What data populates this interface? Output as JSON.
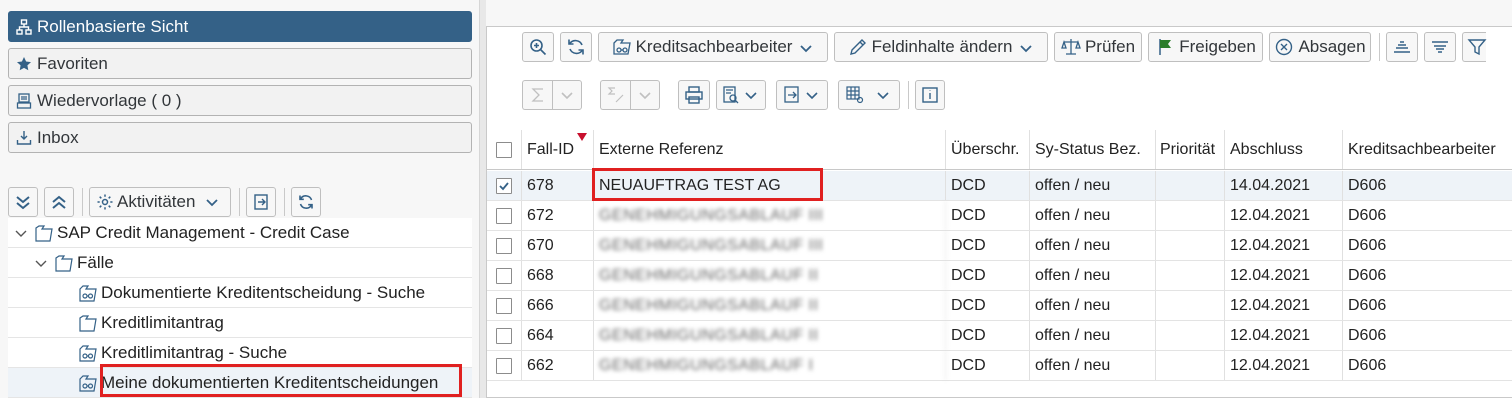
{
  "left_nav": {
    "buttons": [
      {
        "label": "Rollenbasierte Sicht",
        "icon": "hierarchy-icon",
        "active": true
      },
      {
        "label": "Favoriten",
        "icon": "star-icon"
      },
      {
        "label": "Wiedervorlage ( 0  )",
        "icon": "inbox-stack-icon"
      },
      {
        "label": "Inbox",
        "icon": "download-tray-icon"
      }
    ],
    "toolbar": {
      "activities_label": "Aktivitäten"
    },
    "tree": [
      {
        "label": "SAP Credit Management - Credit Case",
        "level": 0,
        "icon": "folder-open-icon"
      },
      {
        "label": "Fälle",
        "level": 1,
        "icon": "folder-open-icon"
      },
      {
        "label": "Dokumentierte Kreditentscheidung - Suche",
        "level": 2,
        "icon": "search-folder-icon"
      },
      {
        "label": "Kreditlimitantrag",
        "level": 2,
        "icon": "folder-icon"
      },
      {
        "label": "Kreditlimitantrag - Suche",
        "level": 2,
        "icon": "search-folder-icon"
      },
      {
        "label": "Meine dokumentierten Kreditentscheidungen",
        "level": 2,
        "icon": "search-folder-icon",
        "selected": true
      }
    ]
  },
  "toolbar": {
    "kreditsachbearbeiter": "Kreditsachbearbeiter",
    "feldinhalte": "Feldinhalte ändern",
    "pruefen": "Prüfen",
    "freigeben": "Freigeben",
    "absagen": "Absagen"
  },
  "table": {
    "headers": [
      "Fall-ID",
      "Externe Referenz",
      "Überschr.",
      "Sy-Status Bez.",
      "Priorität",
      "Abschluss",
      "Kreditsachbearbeiter"
    ],
    "rows": [
      {
        "id": "678",
        "ref": "NEUAUFTRAG TEST AG",
        "ueberschr": "DCD",
        "status": "offen / neu",
        "prio": "",
        "abschluss": "14.04.2021",
        "ksb": "D606",
        "checked": true,
        "blurred": false
      },
      {
        "id": "672",
        "ref": "GENEHMIGUNGSABLAUF III",
        "ueberschr": "DCD",
        "status": "offen / neu",
        "prio": "",
        "abschluss": "12.04.2021",
        "ksb": "D606",
        "checked": false,
        "blurred": true
      },
      {
        "id": "670",
        "ref": "GENEHMIGUNGSABLAUF III",
        "ueberschr": "DCD",
        "status": "offen / neu",
        "prio": "",
        "abschluss": "12.04.2021",
        "ksb": "D606",
        "checked": false,
        "blurred": true
      },
      {
        "id": "668",
        "ref": "GENEHMIGUNGSABLAUF II",
        "ueberschr": "DCD",
        "status": "offen / neu",
        "prio": "",
        "abschluss": "12.04.2021",
        "ksb": "D606",
        "checked": false,
        "blurred": true
      },
      {
        "id": "666",
        "ref": "GENEHMIGUNGSABLAUF II",
        "ueberschr": "DCD",
        "status": "offen / neu",
        "prio": "",
        "abschluss": "12.04.2021",
        "ksb": "D606",
        "checked": false,
        "blurred": true
      },
      {
        "id": "664",
        "ref": "GENEHMIGUNGSABLAUF II",
        "ueberschr": "DCD",
        "status": "offen / neu",
        "prio": "",
        "abschluss": "12.04.2021",
        "ksb": "D606",
        "checked": false,
        "blurred": true
      },
      {
        "id": "662",
        "ref": "GENEHMIGUNGSABLAUF I",
        "ueberschr": "DCD",
        "status": "offen / neu",
        "prio": "",
        "abschluss": "12.04.2021",
        "ksb": "D606",
        "checked": false,
        "blurred": true
      }
    ]
  },
  "colors": {
    "accent": "#346187",
    "highlight": "#e02020",
    "sort_marker": "#c8102e"
  }
}
